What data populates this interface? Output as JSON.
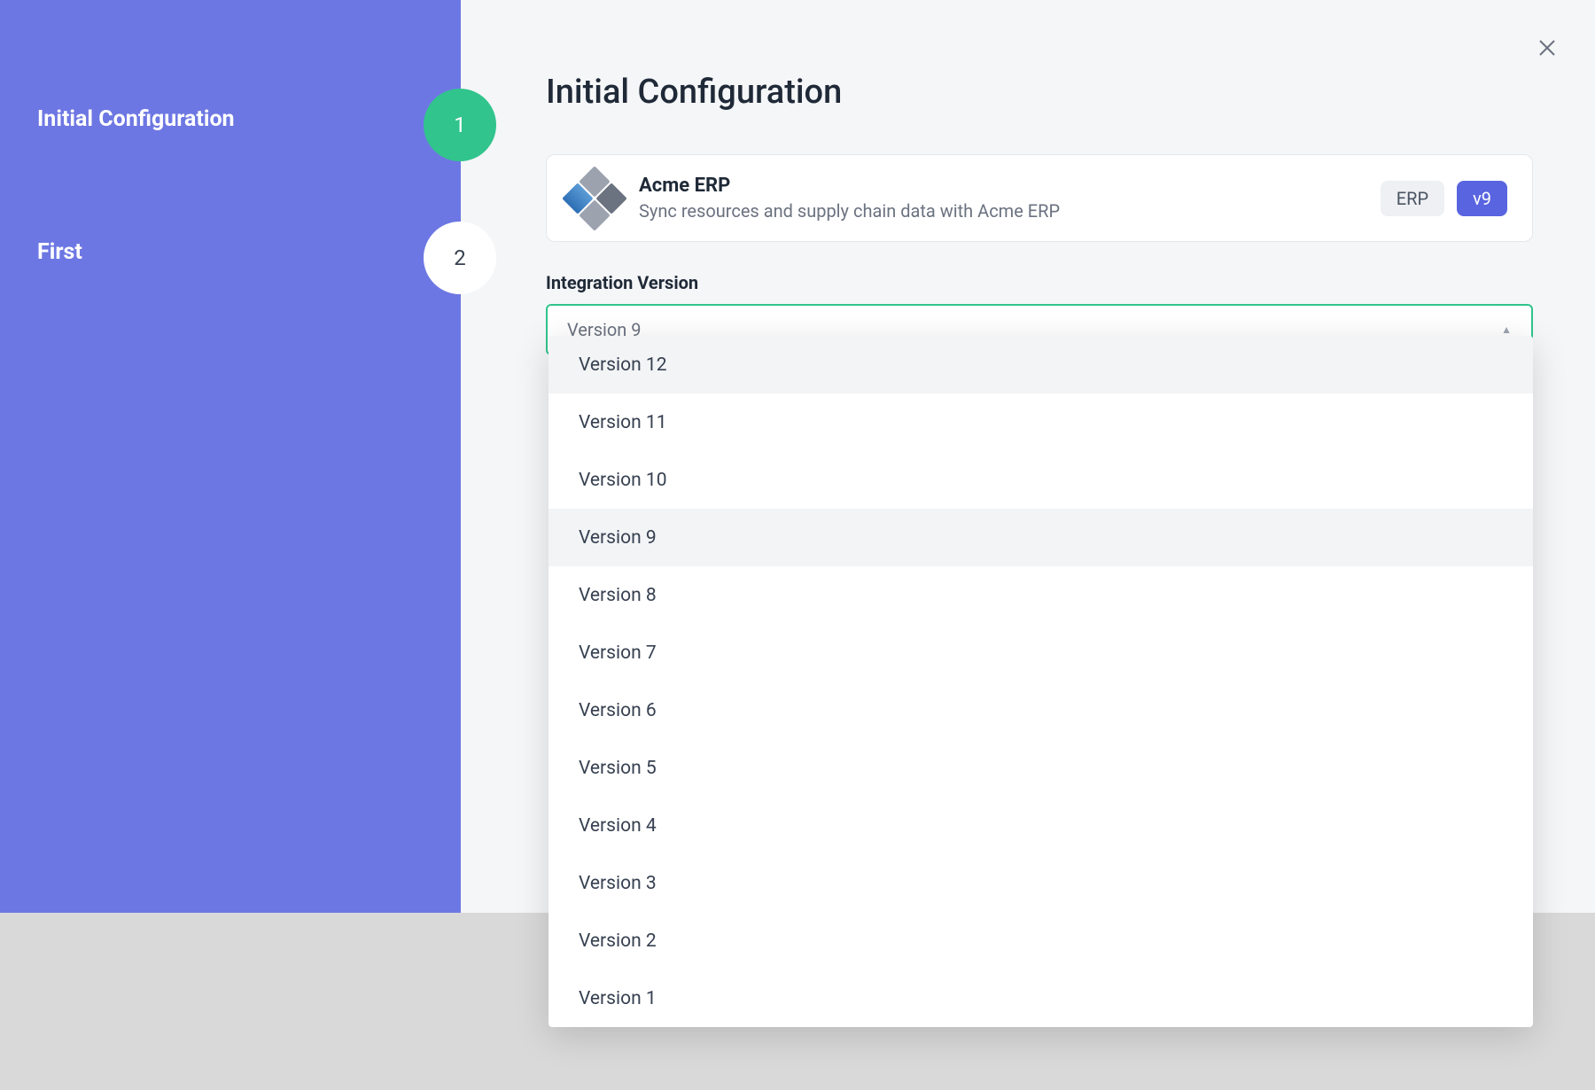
{
  "sidebar": {
    "steps": [
      {
        "label": "Initial Configuration",
        "number": "1",
        "active": true
      },
      {
        "label": "First",
        "number": "2",
        "active": false
      }
    ]
  },
  "main": {
    "title": "Initial Configuration",
    "card": {
      "title": "Acme ERP",
      "description": "Sync resources and supply chain data with Acme ERP",
      "badges": {
        "type": "ERP",
        "version": "v9"
      }
    },
    "version_field": {
      "label": "Integration Version",
      "selected": "Version 9",
      "options": [
        "Version 12",
        "Version 11",
        "Version 10",
        "Version 9",
        "Version 8",
        "Version 7",
        "Version 6",
        "Version 5",
        "Version 4",
        "Version 3",
        "Version 2",
        "Version 1"
      ],
      "highlighted_indexes": [
        0,
        3
      ]
    }
  },
  "icons": {
    "close": "close-icon",
    "chevron_up": "chevron-up-icon"
  }
}
